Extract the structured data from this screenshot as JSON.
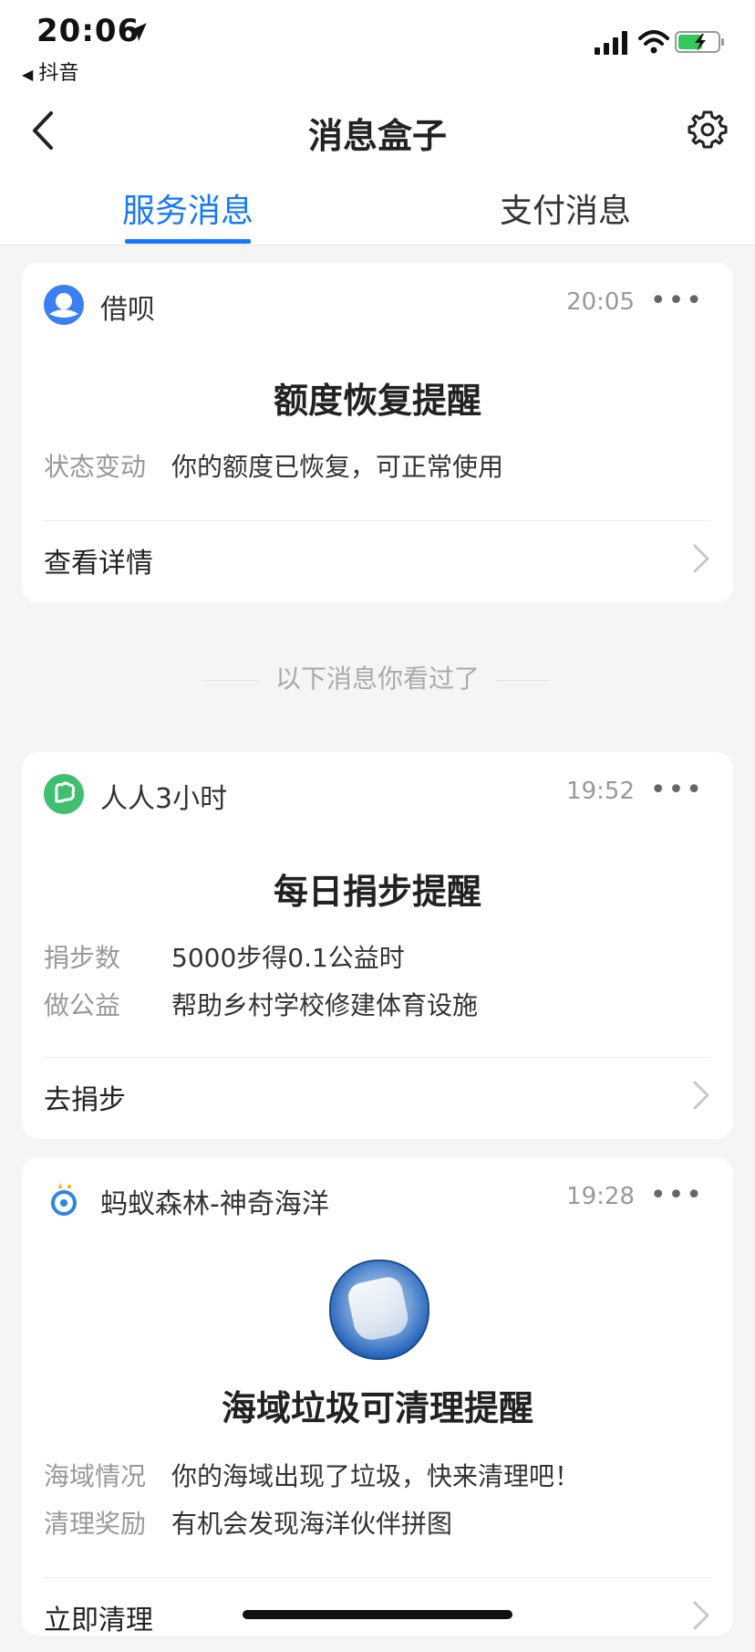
{
  "status_bar": {
    "time": "20:06",
    "back_app": "抖音"
  },
  "nav": {
    "title": "消息盒子"
  },
  "tabs": [
    {
      "label": "服务消息",
      "active": true
    },
    {
      "label": "支付消息",
      "active": false
    }
  ],
  "cards": [
    {
      "source": "借呗",
      "time": "20:05",
      "title": "额度恢复提醒",
      "rows": [
        {
          "key": "状态变动",
          "value": "你的额度已恢复，可正常使用"
        }
      ],
      "action": "查看详情"
    },
    {
      "source": "人人3小时",
      "time": "19:52",
      "title": "每日捐步提醒",
      "rows": [
        {
          "key": "捐步数",
          "value": "5000步得0.1公益时"
        },
        {
          "key": "做公益",
          "value": "帮助乡村学校修建体育设施"
        }
      ],
      "action": "去捐步"
    },
    {
      "source": "蚂蚁森林-神奇海洋",
      "time": "19:28",
      "title": "海域垃圾可清理提醒",
      "rows": [
        {
          "key": "海域情况",
          "value": "你的海域出现了垃圾，快来清理吧！"
        },
        {
          "key": "清理奖励",
          "value": "有机会发现海洋伙伴拼图"
        }
      ],
      "action": "立即清理"
    }
  ],
  "seen_divider": "以下消息你看过了",
  "colors": {
    "accent": "#1677ff",
    "background": "#f5f5f5",
    "card": "#ffffff",
    "muted": "#999999"
  },
  "icons": [
    "location-arrow-icon",
    "back-triangle-icon",
    "signal-icon",
    "wifi-icon",
    "battery-icon",
    "back-chevron-icon",
    "gear-icon",
    "more-icon",
    "chevron-right-icon",
    "jiebei-logo-icon",
    "renren-logo-icon",
    "antforest-logo-icon"
  ]
}
